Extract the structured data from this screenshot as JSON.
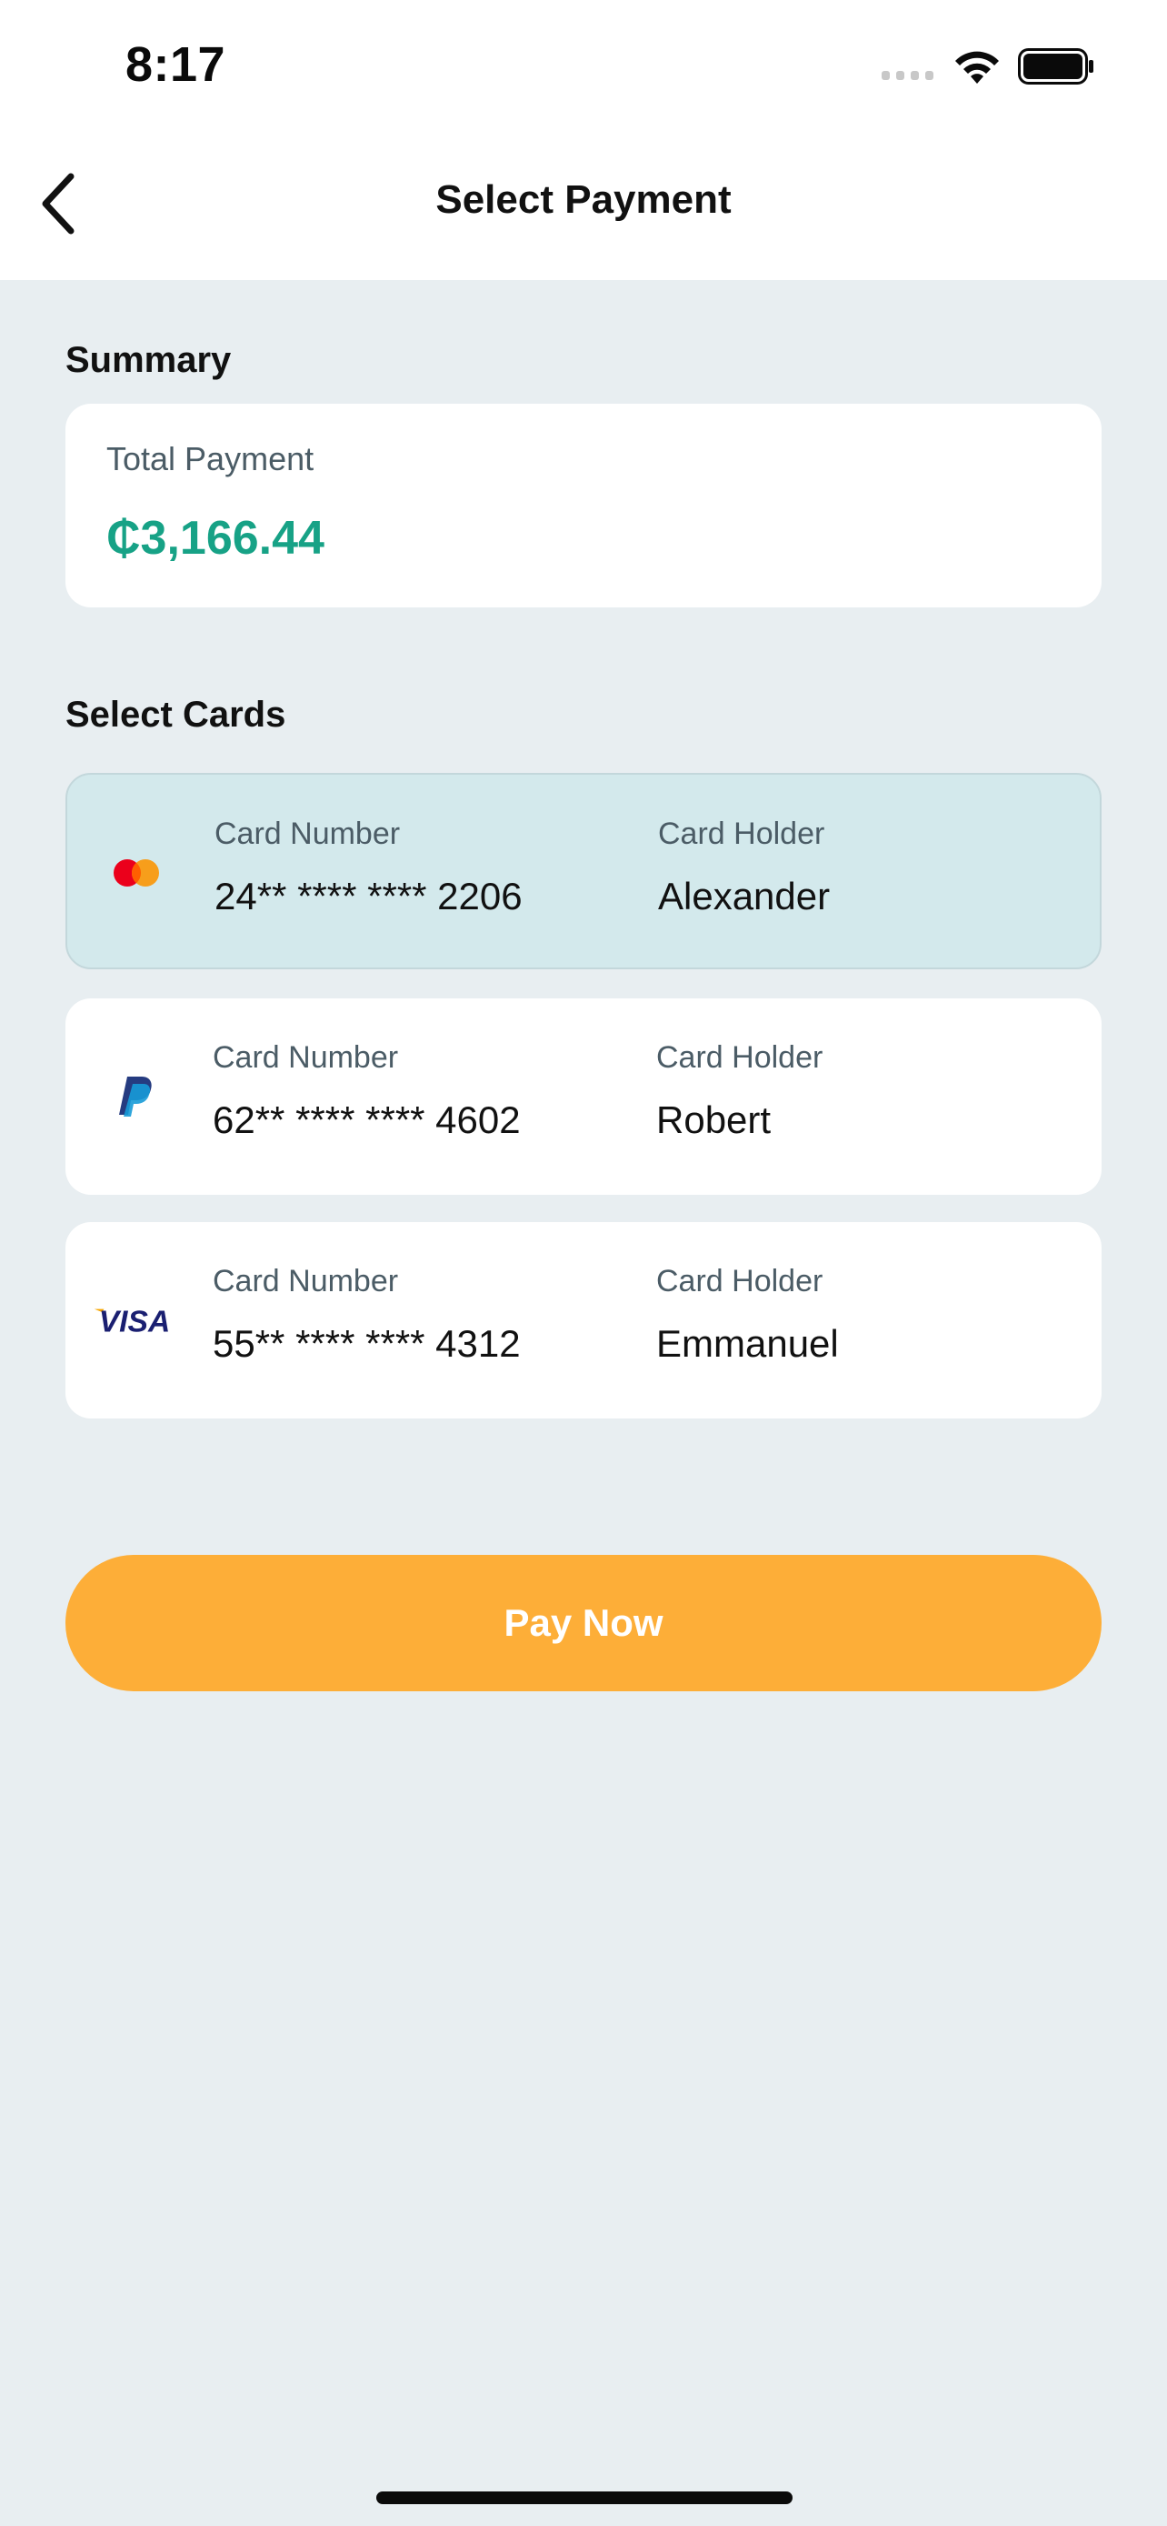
{
  "status_bar": {
    "time": "8:17"
  },
  "header": {
    "title": "Select Payment",
    "back_icon": "chevron-left-icon"
  },
  "summary": {
    "section_title": "Summary",
    "label": "Total Payment",
    "amount": "₵3,166.44",
    "amount_color": "#17a286"
  },
  "cards_section": {
    "title": "Select Cards",
    "number_label": "Card Number",
    "holder_label": "Card Holder",
    "selected_color": "#d3e9ec",
    "items": [
      {
        "brand": "mastercard-icon",
        "number": "24** **** **** 2206",
        "holder": "Alexander",
        "selected": true
      },
      {
        "brand": "paypal-icon",
        "number": "62** **** **** 4602",
        "holder": "Robert",
        "selected": false
      },
      {
        "brand": "visa-icon",
        "number": "55** **** **** 4312",
        "holder": "Emmanuel",
        "selected": false
      }
    ]
  },
  "pay_button": {
    "label": "Pay Now",
    "color": "#fdae38"
  }
}
